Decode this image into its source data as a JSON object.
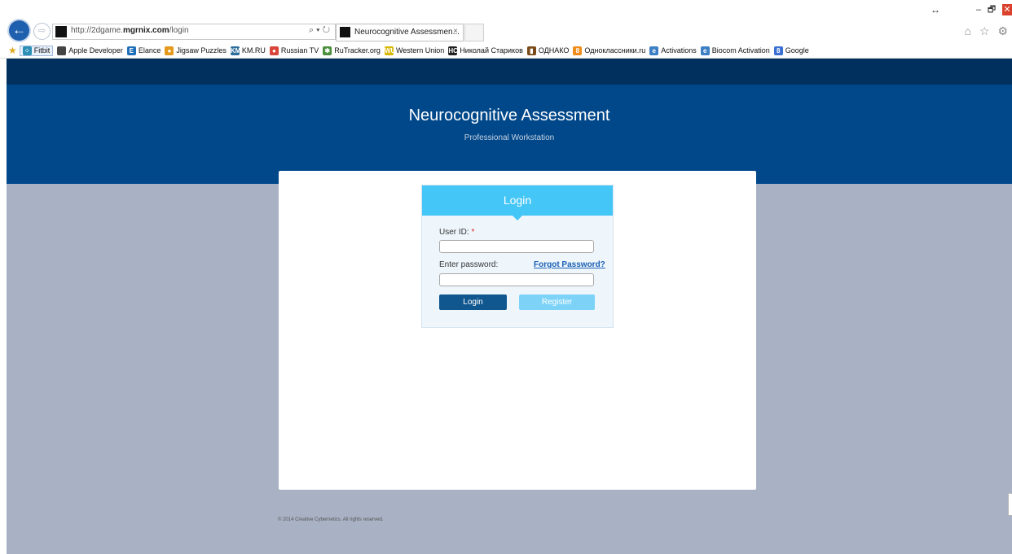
{
  "window": {
    "resize_glyph": "↔",
    "minimize": "–",
    "restore": "🗗",
    "close": "✕"
  },
  "nav": {
    "back_glyph": "←",
    "forward_glyph": "⇨",
    "url_prefix": "http://2dgame.",
    "url_domain": "mgrnix.com",
    "url_path": "/login",
    "url_tools": "⌕ ▾ ↻",
    "tab_title": "Neurocognitive Assessmen...",
    "tab_close": "×",
    "right_icons": "⌂ ☆ ⚙"
  },
  "favorites": {
    "star": "★",
    "items": [
      {
        "label": "Fitbit",
        "icon": "fitbit-icon",
        "glyph": "⁘",
        "color": "#2a8fb5"
      },
      {
        "label": "Apple Developer",
        "icon": "apple-icon",
        "glyph": "",
        "color": "#444444"
      },
      {
        "label": "Elance",
        "icon": "elance-icon",
        "glyph": "E",
        "color": "#1e6fb8"
      },
      {
        "label": "Jigsaw Puzzles",
        "icon": "jigsaw-icon",
        "glyph": "●",
        "color": "#e59a1c"
      },
      {
        "label": "KM.RU",
        "icon": "kmru-icon",
        "glyph": "KM",
        "color": "#2d6c9c"
      },
      {
        "label": "Russian TV",
        "icon": "russian-tv-icon",
        "glyph": "●",
        "color": "#d9453a"
      },
      {
        "label": "RuTracker.org",
        "icon": "rutracker-icon",
        "glyph": "✱",
        "color": "#4a8f3c"
      },
      {
        "label": "Western Union",
        "icon": "western-union-icon",
        "glyph": "WU",
        "color": "#d8b800"
      },
      {
        "label": "Николай Стариков",
        "icon": "starikov-icon",
        "glyph": "НС",
        "color": "#222222"
      },
      {
        "label": "ОДНАКО",
        "icon": "odnako-icon",
        "glyph": "▮",
        "color": "#7a4a1a"
      },
      {
        "label": "Одноклассники.ru",
        "icon": "odnoklassniki-icon",
        "glyph": "8",
        "color": "#f08c1a"
      },
      {
        "label": "Activations",
        "icon": "ie-page-icon",
        "glyph": "e",
        "color": "#3d7fc4"
      },
      {
        "label": "Biocom Activation",
        "icon": "ie-page-icon",
        "glyph": "e",
        "color": "#3d7fc4"
      },
      {
        "label": "Google",
        "icon": "google-icon",
        "glyph": "8",
        "color": "#3b6fd4"
      }
    ]
  },
  "app": {
    "title": "Neurocognitive Assessment",
    "subtitle": "Professional Workstation"
  },
  "login": {
    "header": "Login",
    "user_id_label": "User ID:",
    "required_mark": "*",
    "password_label": "Enter password:",
    "forgot_link": "Forgot Password?",
    "user_id_value": "",
    "password_value": "",
    "login_button": "Login",
    "register_button": "Register"
  },
  "footer": {
    "text": "© 2014 Creative Cybernetics. All rights reserved."
  },
  "colors": {
    "nav_bar": "#02305e",
    "banner": "#01488a",
    "page_bg": "#a9b1c4",
    "login_header": "#44c6f6",
    "login_button": "#10578f",
    "register_button": "#7dd3f7"
  }
}
